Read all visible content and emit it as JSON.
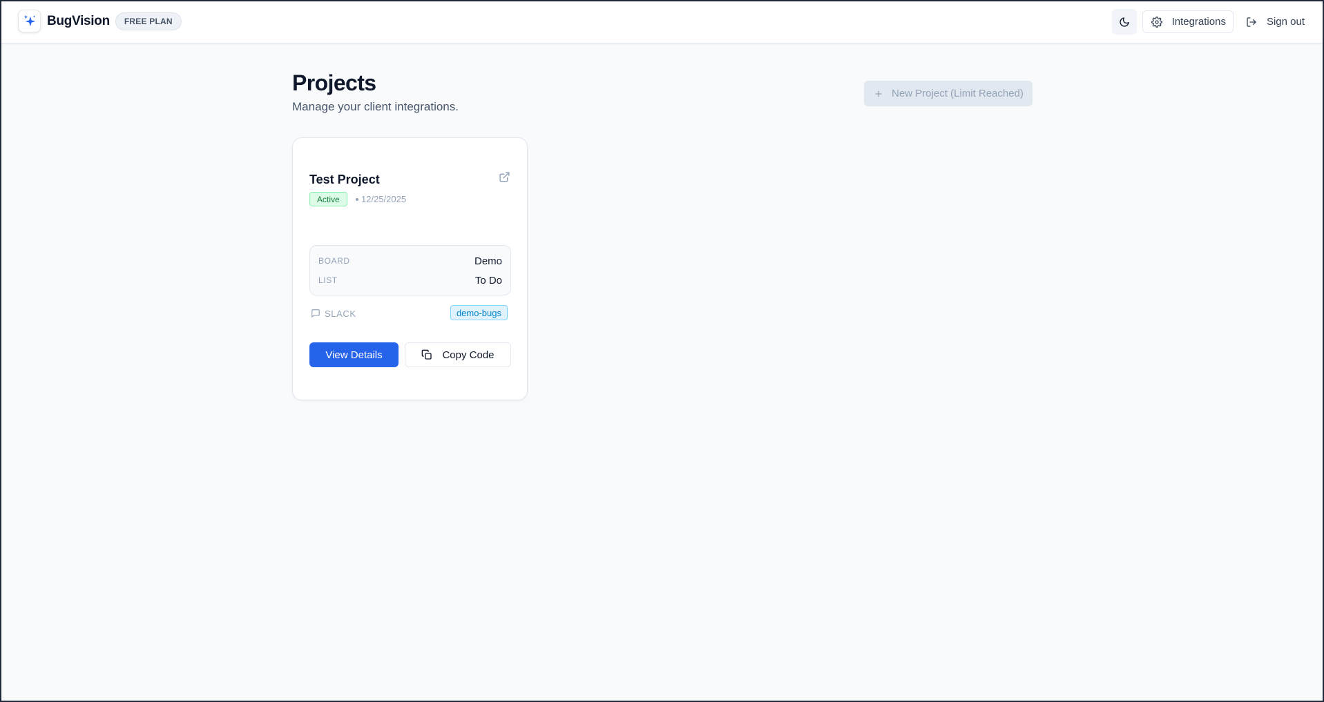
{
  "header": {
    "brand_name": "BugVision",
    "plan_badge": "FREE PLAN",
    "integrations_label": "Integrations",
    "signout_label": "Sign out"
  },
  "page": {
    "title": "Projects",
    "subtitle": "Manage your client integrations.",
    "new_project_label": "New Project (Limit Reached)"
  },
  "project_card": {
    "title": "Test Project",
    "status": "Active",
    "date": "12/25/2025",
    "board_label": "BOARD",
    "board_value": "Demo",
    "list_label": "LIST",
    "list_value": "To Do",
    "slack_label": "SLACK",
    "slack_channel": "demo-bugs",
    "view_details_label": "View Details",
    "copy_code_label": "Copy Code"
  },
  "colors": {
    "primary": "#2563eb",
    "status_active": "#15803d",
    "channel_tag": "#0284c7",
    "background": "#f8fafc"
  },
  "icons": {
    "logo": "sparkle-icon",
    "theme": "moon-icon",
    "integrations": "gear-icon",
    "signout": "logout-icon",
    "new_project": "plus-icon",
    "external_link": "external-link-icon",
    "slack": "chat-bubble-icon",
    "copy": "copy-icon"
  }
}
